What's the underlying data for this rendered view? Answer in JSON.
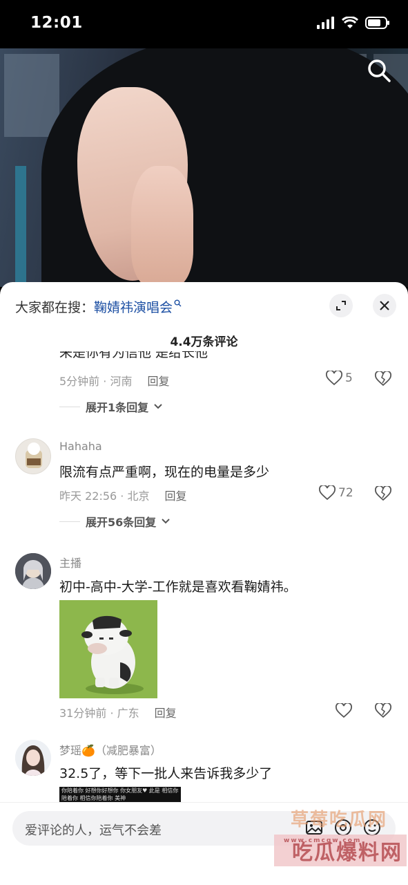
{
  "status": {
    "time": "12:01"
  },
  "panel": {
    "hot_search_prefix": "大家都在搜：",
    "hot_search_keyword": "鞠婧祎演唱会",
    "comment_count": "4.4万条评论"
  },
  "comments": [
    {
      "truncated_text": "来是你有为信他 是给长他",
      "time_location": "5分钟前 · 河南",
      "reply_label": "回复",
      "likes": "5",
      "expand_label": "展开1条回复"
    },
    {
      "username": "Hahaha",
      "text": "限流有点严重啊，现在的电量是多少",
      "time_location": "昨天 22:56 · 北京",
      "reply_label": "回复",
      "likes": "72",
      "expand_label": "展开56条回复"
    },
    {
      "username": "主播",
      "text": "初中-高中-大学-工作就是喜欢看鞠婧祎。",
      "time_location": "31分钟前 · 广东",
      "reply_label": "回复",
      "likes": ""
    },
    {
      "username": "梦瑶🍊（减肥暴富）",
      "text": "32.5了，等下一批人来告诉我多少了",
      "sticker_text": "你陪着你    好想你好想你    你女朋友♥ 此是    相信你陪着你    相信你陪着你    美神"
    }
  ],
  "input": {
    "placeholder": "爱评论的人，运气不会差"
  },
  "watermark": {
    "text1": "草莓吃瓜网",
    "text2": "吃瓜爆料网",
    "url": "www.cmcgw.com"
  },
  "colors": {
    "link_blue": "#1c4fa3",
    "meta_gray": "#999999",
    "panel_bg": "#ffffff"
  }
}
